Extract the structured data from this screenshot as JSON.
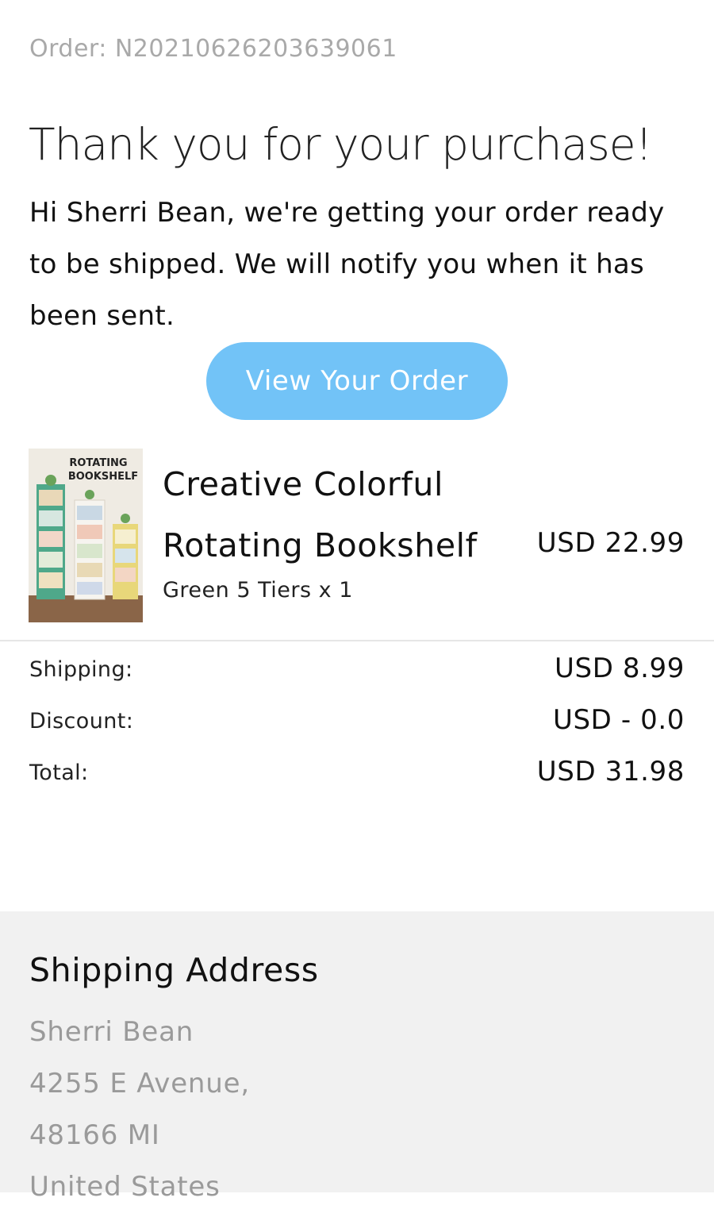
{
  "order": {
    "label": "Order: N20210626203639061"
  },
  "header": {
    "title": "Thank you for your purchase!"
  },
  "intro": {
    "text": "Hi Sherri Bean, we're getting your order ready to be shipped. We will notify you when it has been sent."
  },
  "cta": {
    "label": "View Your Order"
  },
  "product": {
    "image_text_line1": "ROTATING",
    "image_text_line2": "BOOKSHELF",
    "name": "Creative Colorful Rotating Bookshelf",
    "variant": "Green 5 Tiers x 1",
    "price": "USD 22.99"
  },
  "summary": [
    {
      "label": "Shipping:",
      "value": "USD 8.99"
    },
    {
      "label": "Discount:",
      "value": "USD - 0.0"
    },
    {
      "label": "Total:",
      "value": "USD 31.98"
    }
  ],
  "shipping": {
    "title": "Shipping Address",
    "lines": [
      "Sherri Bean",
      "4255 E Avenue,",
      "48166 MI",
      "United States"
    ]
  },
  "colors": {
    "button": "#72c3f7",
    "panel": "#f1f1f1",
    "muted": "#9a9a9a"
  }
}
